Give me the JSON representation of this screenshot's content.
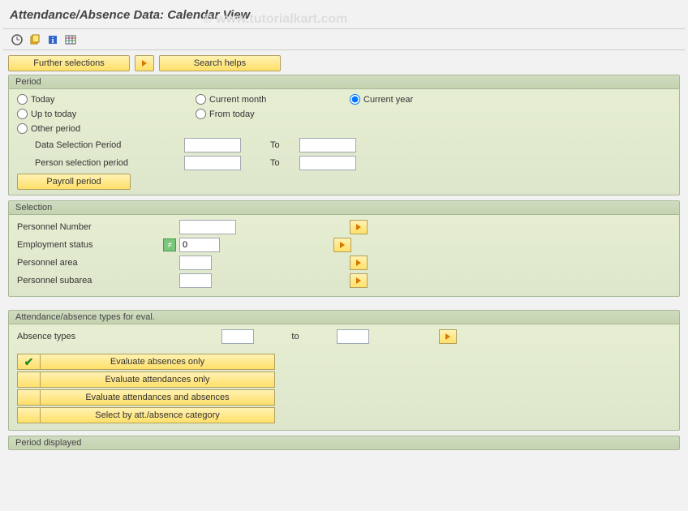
{
  "title": "Attendance/Absence Data: Calendar View",
  "watermark": "© www.tutorialkart.com",
  "buttons": {
    "further_selections": "Further selections",
    "search_helps": "Search helps",
    "payroll_period": "Payroll period"
  },
  "period": {
    "header": "Period",
    "today": "Today",
    "current_month": "Current month",
    "current_year": "Current year",
    "up_to_today": "Up to today",
    "from_today": "From today",
    "other_period": "Other period",
    "data_selection_period": "Data Selection Period",
    "person_selection_period": "Person selection period",
    "to": "To",
    "data_from": "",
    "data_to": "",
    "person_from": "",
    "person_to": ""
  },
  "selection": {
    "header": "Selection",
    "personnel_number": "Personnel Number",
    "employment_status": "Employment status",
    "personnel_area": "Personnel area",
    "personnel_subarea": "Personnel subarea",
    "emp_status_value": "0",
    "pn_value": "",
    "area_value": "",
    "subarea_value": ""
  },
  "eval": {
    "header": "Attendance/absence types for eval.",
    "absence_types": "Absence types",
    "to": "to",
    "from_value": "",
    "to_value": "",
    "eval_absences_only": "Evaluate absences only",
    "eval_attendances_only": "Evaluate attendances only",
    "eval_both": "Evaluate attendances and absences",
    "select_by_category": "Select by att./absence category"
  },
  "period_displayed": {
    "header": "Period displayed"
  },
  "icons": {
    "execute": "execute",
    "variant": "variant",
    "info": "info",
    "table": "table"
  }
}
